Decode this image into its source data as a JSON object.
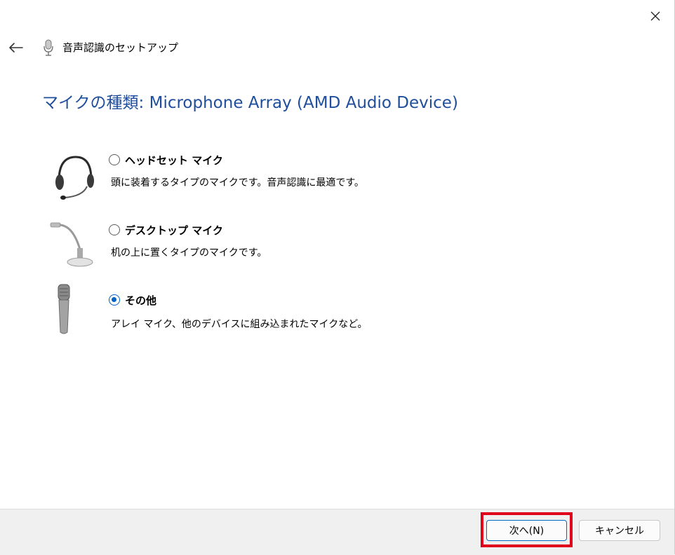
{
  "window": {
    "close_icon": "close-icon",
    "back_icon": "back-arrow-icon"
  },
  "header": {
    "title": "音声認識のセットアップ",
    "icon": "microphone-icon"
  },
  "main": {
    "heading": "マイクの種類: Microphone Array (AMD Audio Device)",
    "options": [
      {
        "label": "ヘッドセット マイク",
        "description": "頭に装着するタイプのマイクです。音声認識に最適です。",
        "checked": false,
        "icon": "headset-icon"
      },
      {
        "label": "デスクトップ マイク",
        "description": "机の上に置くタイプのマイクです。",
        "checked": false,
        "icon": "desktop-microphone-icon"
      },
      {
        "label": "その他",
        "description": "アレイ マイク、他のデバイスに組み込まれたマイクなど。",
        "checked": true,
        "icon": "handheld-microphone-icon"
      }
    ]
  },
  "footer": {
    "next_label": "次へ(N)",
    "cancel_label": "キャンセル",
    "highlight_color": "#e0001b",
    "accent": "#0062c4",
    "heading_color": "#1f4e9c"
  }
}
